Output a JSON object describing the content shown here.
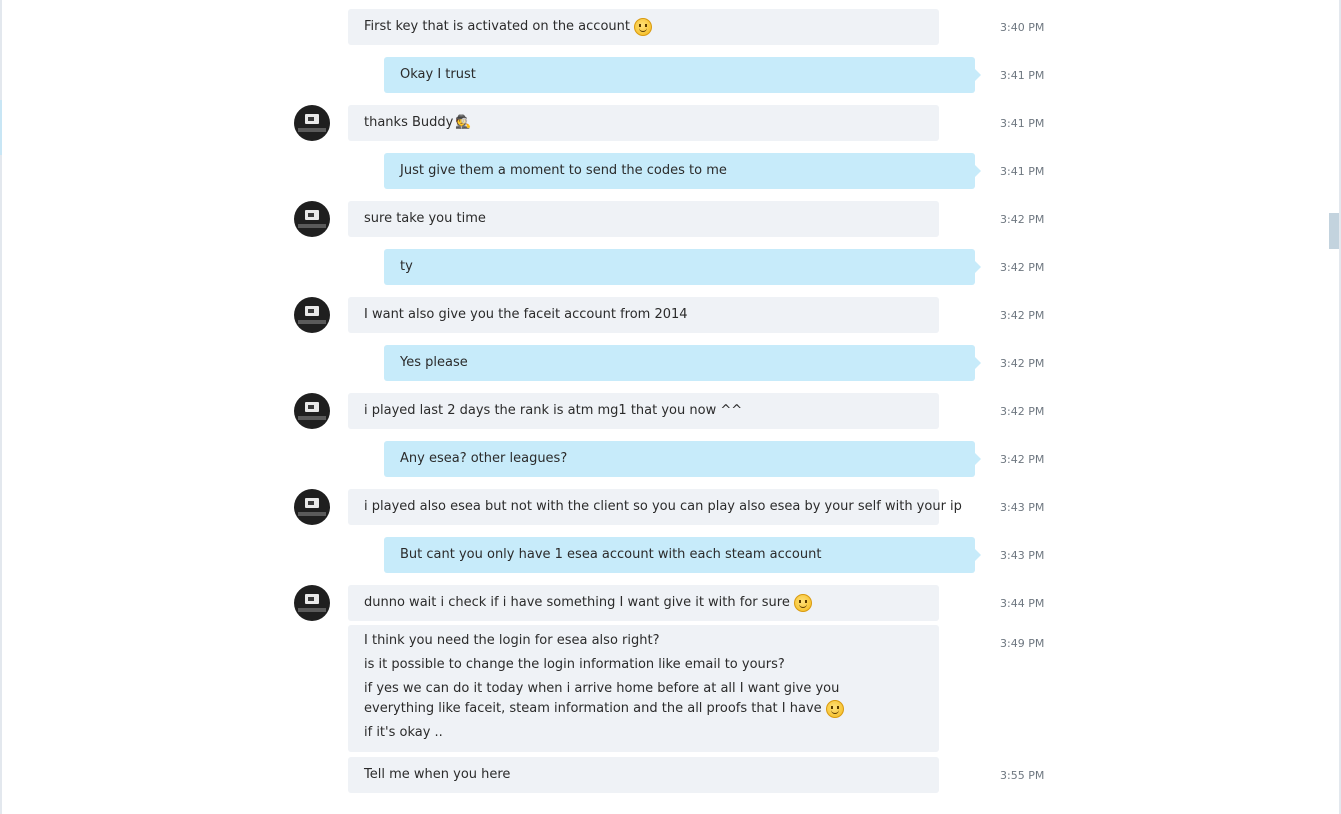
{
  "messages": [
    {
      "text": "First key that is activated on the account",
      "time": "3:40 PM"
    },
    {
      "text": "Okay I trust",
      "time": "3:41 PM"
    },
    {
      "text": "thanks Buddy",
      "emoji_glyph": "🕵",
      "time": "3:41 PM"
    },
    {
      "text": "Just give them a moment to send the codes to me",
      "time": "3:41 PM"
    },
    {
      "text": "sure take you time",
      "time": "3:42 PM"
    },
    {
      "text": "ty",
      "time": "3:42 PM"
    },
    {
      "text": "I want also give you the faceit account from 2014",
      "time": "3:42 PM"
    },
    {
      "text": "Yes please",
      "time": "3:42 PM"
    },
    {
      "text": "i played last 2 days the rank is atm mg1 that you now ^^",
      "time": "3:42 PM"
    },
    {
      "text": "Any esea? other leagues?",
      "time": "3:42 PM"
    },
    {
      "text": "i played also esea but not with the client so you can play also esea by your self with your ip",
      "time": "3:43 PM"
    },
    {
      "text": "But cant you only have 1 esea account with each steam account",
      "time": "3:43 PM"
    },
    {
      "text": "dunno wait i check if i have something I want give it with for sure",
      "time": "3:44 PM"
    },
    {
      "lines": [
        "I think you need the login for esea also right?",
        "is it possible to change the login information like email to yours?",
        "if yes we can do it today when i arrive home before at all I want give you everything like faceit, steam information and the all proofs that I have",
        "if it's okay .."
      ],
      "time": "3:49 PM"
    },
    {
      "text": "Tell me when you here",
      "time": "3:55 PM"
    }
  ]
}
